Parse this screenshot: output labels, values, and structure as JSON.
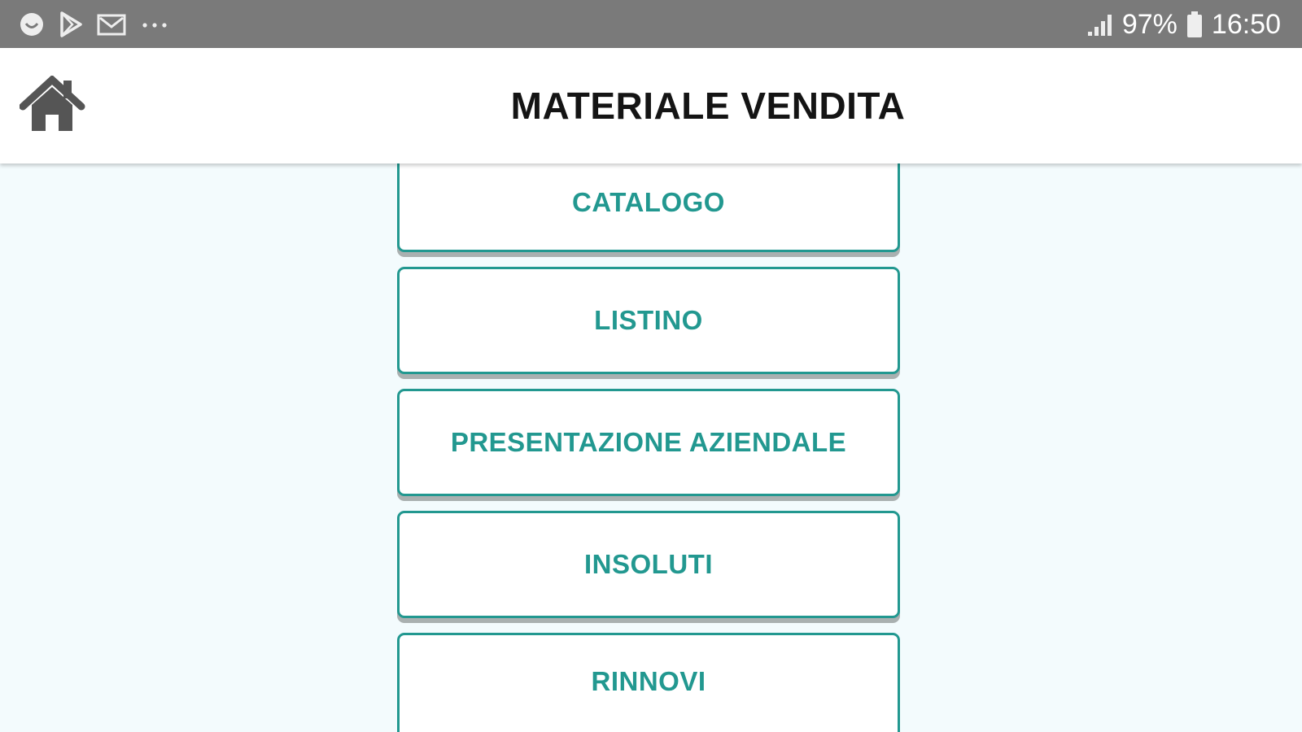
{
  "status_bar": {
    "notification_icons": [
      "smiley-icon",
      "play-store-icon",
      "email-icon",
      "more-dots-icon"
    ],
    "battery_percent": "97%",
    "time": "16:50"
  },
  "header": {
    "title": "MATERIALE VENDITA",
    "home_icon": "home-icon"
  },
  "menu": {
    "items": [
      {
        "label": "CATALOGO"
      },
      {
        "label": "LISTINO"
      },
      {
        "label": "PRESENTAZIONE AZIENDALE"
      },
      {
        "label": "INSOLUTI"
      },
      {
        "label": "RINNOVI"
      }
    ]
  },
  "colors": {
    "status_bar_bg": "#7a7a7a",
    "header_bg": "#ffffff",
    "page_bg": "#f3fbfd",
    "accent_teal": "#229890",
    "title_text": "#141414"
  }
}
